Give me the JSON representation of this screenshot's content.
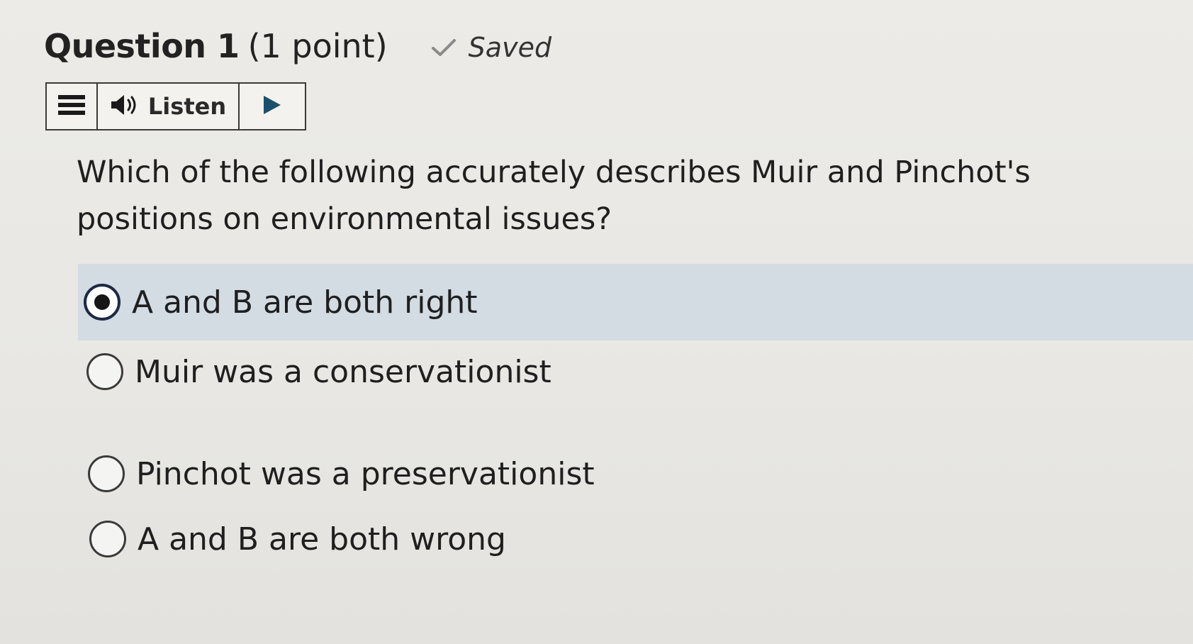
{
  "question": {
    "title": "Question 1",
    "points": "(1 point)",
    "status": "Saved"
  },
  "listen_bar": {
    "listen_label": "Listen"
  },
  "prompt": {
    "text": "Which of the following accurately describes Muir and Pinchot's positions on environmental issues?"
  },
  "options": [
    {
      "label": "A and B are both right",
      "selected": true
    },
    {
      "label": "Muir was a conservationist",
      "selected": false
    },
    {
      "label": "Pinchot was a preservationist",
      "selected": false
    },
    {
      "label": "A and B are both wrong",
      "selected": false
    }
  ],
  "colors": {
    "selected_row": "#d3dbe3",
    "play_icon": "#1c4f6b"
  }
}
